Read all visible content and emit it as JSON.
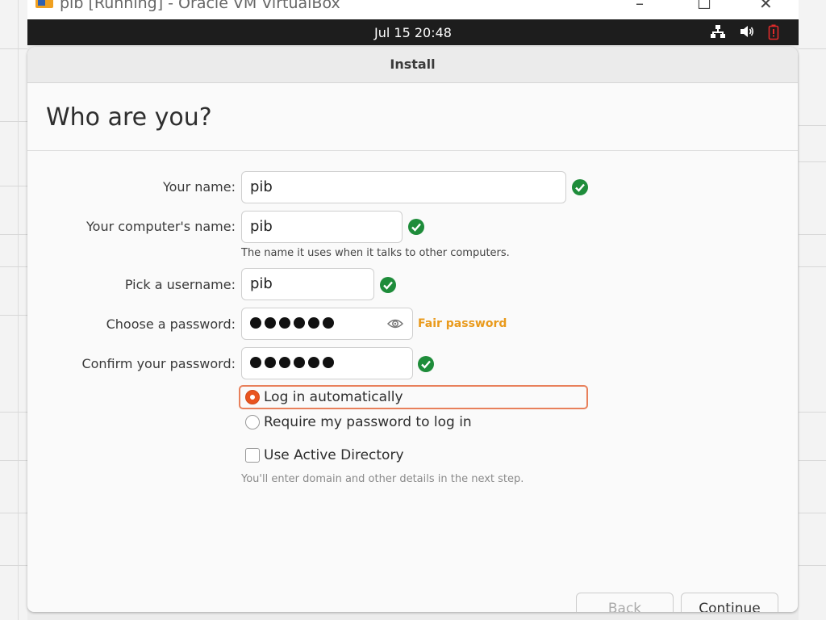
{
  "vbox_window": {
    "title": "pib [Running] - Oracle VM VirtualBox",
    "controls": {
      "minimize": "–",
      "maximize": "☐",
      "close": "✕"
    }
  },
  "topbar": {
    "clock": "Jul 15  20:48",
    "icons": [
      "network-icon",
      "volume-icon",
      "battery-icon"
    ]
  },
  "dialog": {
    "header_title": "Install",
    "page_title": "Who are you?"
  },
  "form": {
    "your_name": {
      "label": "Your name:",
      "value": "pib"
    },
    "computer_name": {
      "label": "Your computer's name:",
      "value": "pib",
      "hint": "The name it uses when it talks to other computers."
    },
    "username": {
      "label": "Pick a username:",
      "value": "pib"
    },
    "password": {
      "label": "Choose a password:",
      "strength": "Fair password",
      "masked_length": 6
    },
    "confirm_password": {
      "label": "Confirm your password:",
      "masked_length": 6
    }
  },
  "login_options": {
    "auto_login": {
      "label": "Log in automatically",
      "selected": true
    },
    "require_password": {
      "label": "Require my password to log in",
      "selected": false
    }
  },
  "active_directory": {
    "label": "Use Active Directory",
    "checked": false,
    "hint": "You'll enter domain and other details in the next step."
  },
  "buttons": {
    "back": "Back",
    "continue": "Continue"
  },
  "colors": {
    "accent": "#e9541f",
    "valid_green": "#1e8c3a",
    "warning": "#e99a1c",
    "topbar_bg": "#1d1d1d"
  }
}
